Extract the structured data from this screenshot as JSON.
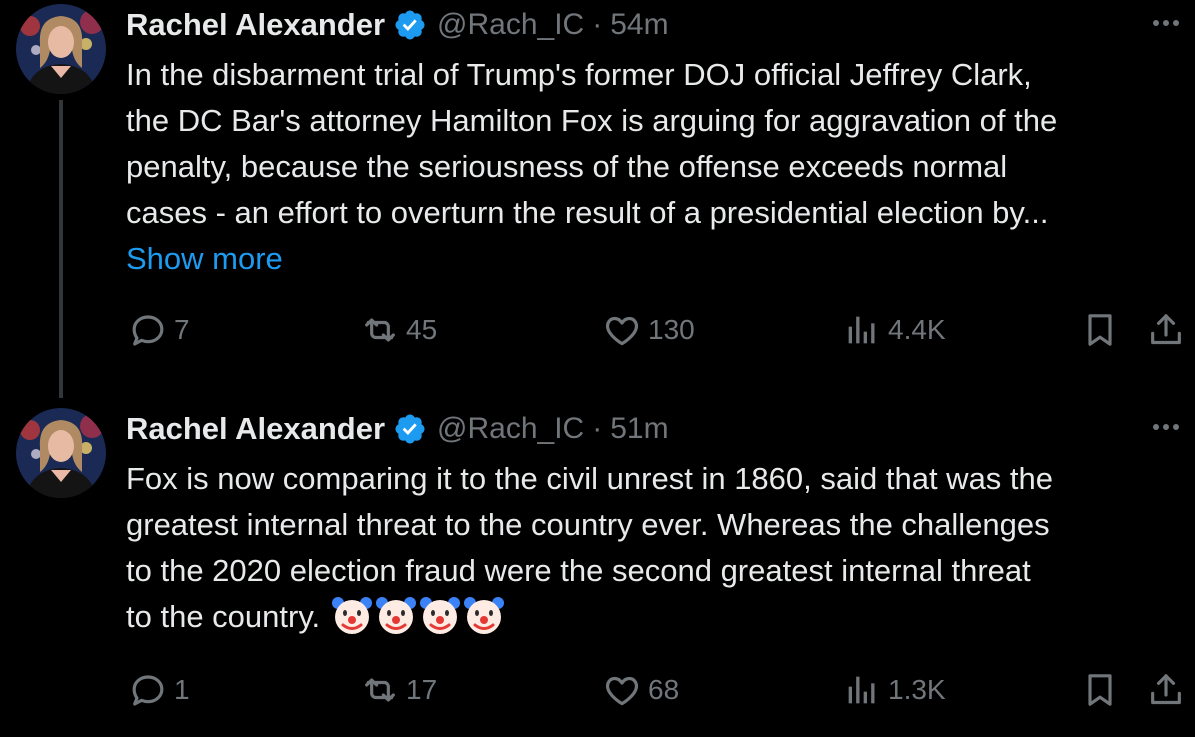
{
  "tweets": [
    {
      "author": "Rachel Alexander",
      "handle": "@Rach_IC",
      "separator": "·",
      "time": "54m",
      "text_lines": [
        "In the disbarment trial of Trump's former DOJ official Jeffrey Clark,",
        "the DC Bar's attorney Hamilton Fox is arguing for aggravation of the",
        "penalty, because the seriousness of the offense exceeds normal",
        "cases - an effort to overturn the result of a presidential election by..."
      ],
      "show_more": "Show more",
      "replies": "7",
      "reposts": "45",
      "likes": "130",
      "views": "4.4K"
    },
    {
      "author": "Rachel Alexander",
      "handle": "@Rach_IC",
      "separator": "·",
      "time": "51m",
      "text_lines": [
        "Fox is now comparing it to the civil unrest in 1860, said that was the",
        "greatest internal threat to the country ever. Whereas the challenges",
        "to the 2020 election fraud were the second greatest internal threat",
        "to the country."
      ],
      "emojis": [
        "clown-face",
        "clown-face",
        "clown-face",
        "clown-face"
      ],
      "replies": "1",
      "reposts": "17",
      "likes": "68",
      "views": "1.3K"
    }
  ],
  "icons": [
    "avatar",
    "verified-badge-icon",
    "more-icon",
    "reply-icon",
    "repost-icon",
    "like-icon",
    "views-icon",
    "bookmark-icon",
    "share-icon"
  ],
  "colors": {
    "background": "#000000",
    "text": "#e7e9ea",
    "muted": "#71767b",
    "accent": "#1d9bf0",
    "thread_line": "#333639"
  }
}
